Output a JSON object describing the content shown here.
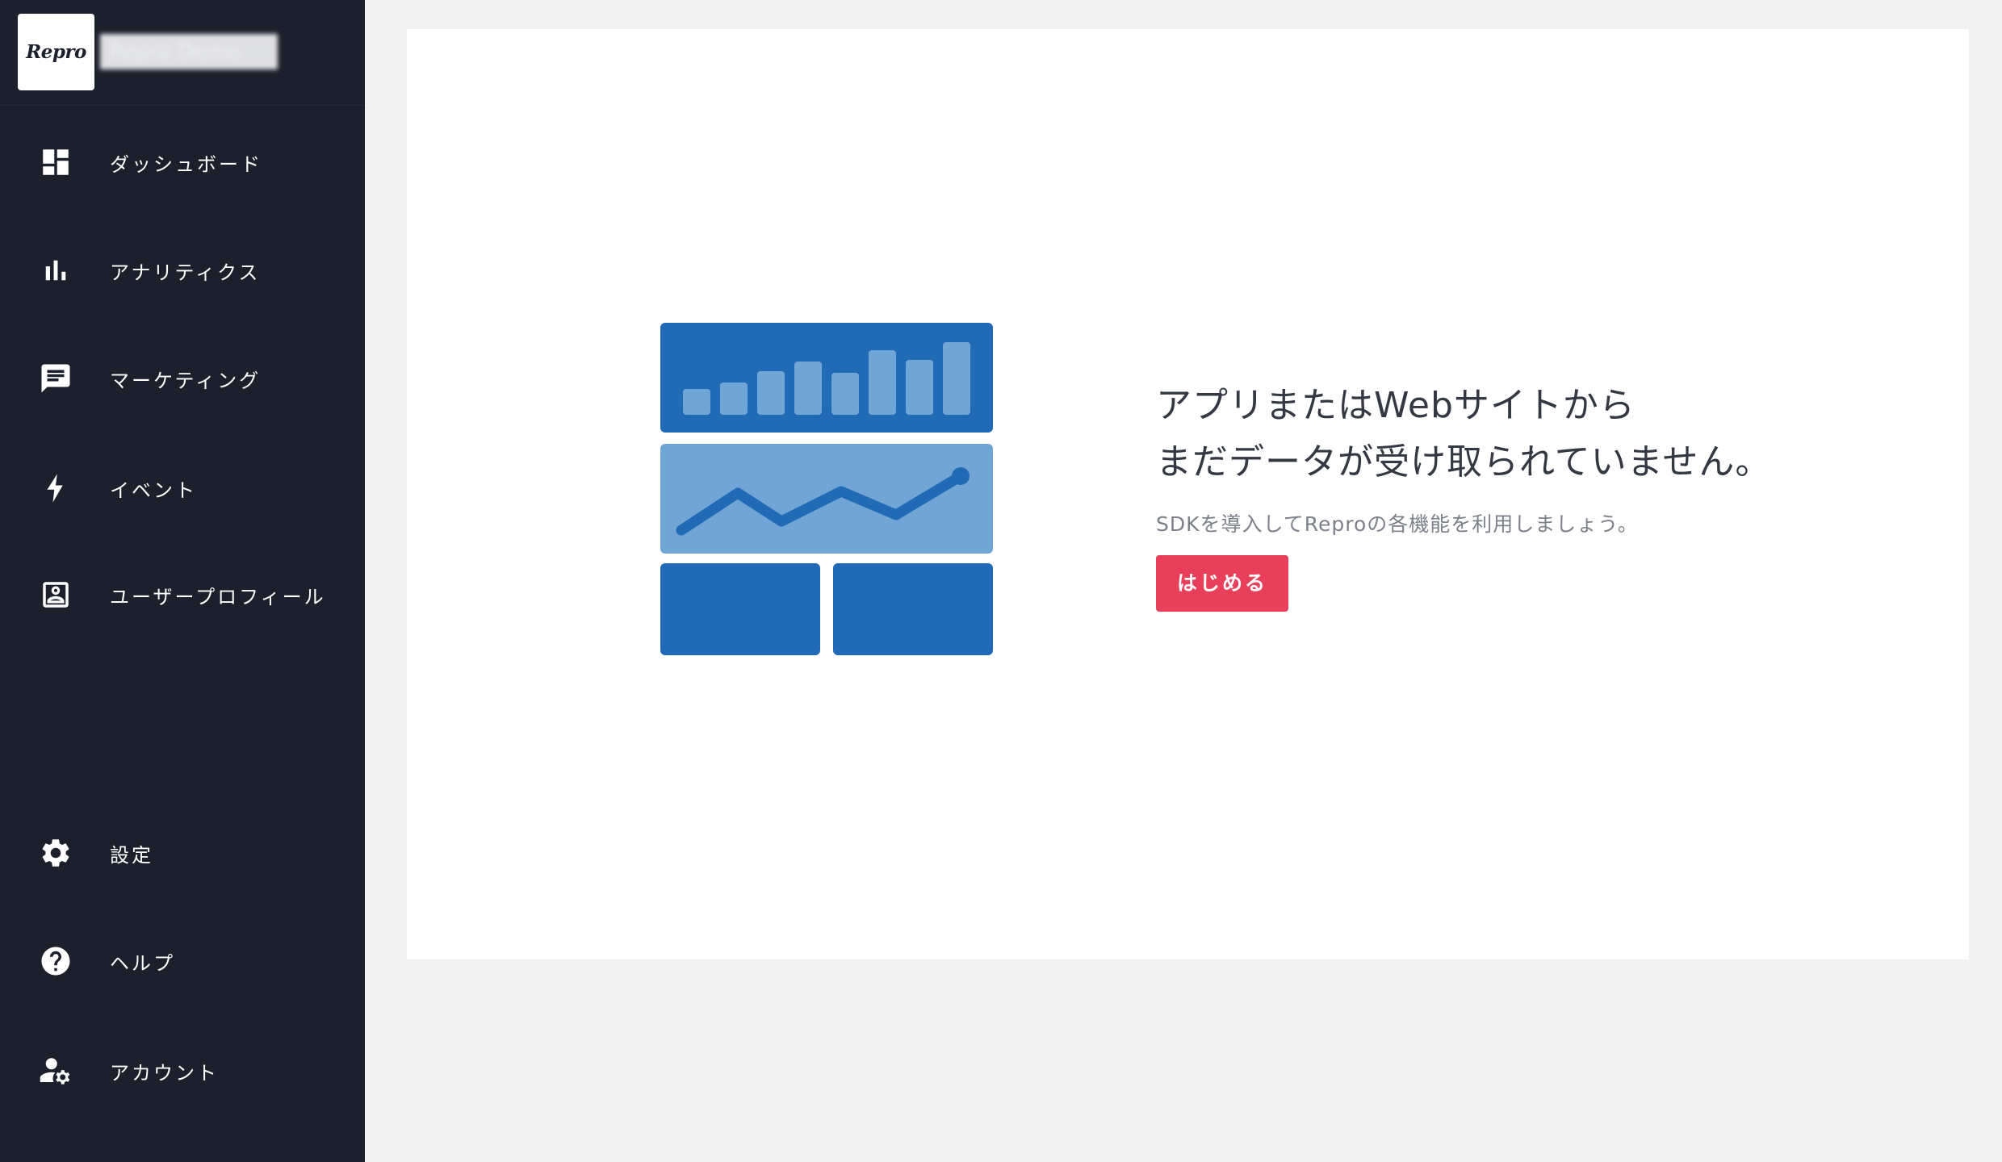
{
  "brand": {
    "logo": "Repro",
    "project_name": "Repro Demo"
  },
  "sidebar": {
    "items": [
      {
        "label": "ダッシュボード",
        "icon": "dashboard-icon"
      },
      {
        "label": "アナリティクス",
        "icon": "bar-chart-icon"
      },
      {
        "label": "マーケティング",
        "icon": "chat-bubble-icon"
      },
      {
        "label": "イベント",
        "icon": "lightning-icon"
      },
      {
        "label": "ユーザープロフィール",
        "icon": "profile-card-icon"
      }
    ],
    "bottom_items": [
      {
        "label": "設定",
        "icon": "gear-icon"
      },
      {
        "label": "ヘルプ",
        "icon": "help-icon"
      },
      {
        "label": "アカウント",
        "icon": "account-settings-icon"
      }
    ]
  },
  "empty_state": {
    "headline_line1": "アプリまたはWebサイトから",
    "headline_line2": "まだデータが受け取られていません。",
    "subtext": "SDKを導入してReproの各機能を利用しましょう。",
    "button_label": "はじめる",
    "illustration_icon": "dashboard-illustration-icon"
  },
  "colors": {
    "sidebar_bg": "#1c1f2c",
    "accent_button": "#e8405a",
    "illustration_dark_blue": "#216ab6",
    "illustration_light_blue": "#71a5d5"
  }
}
